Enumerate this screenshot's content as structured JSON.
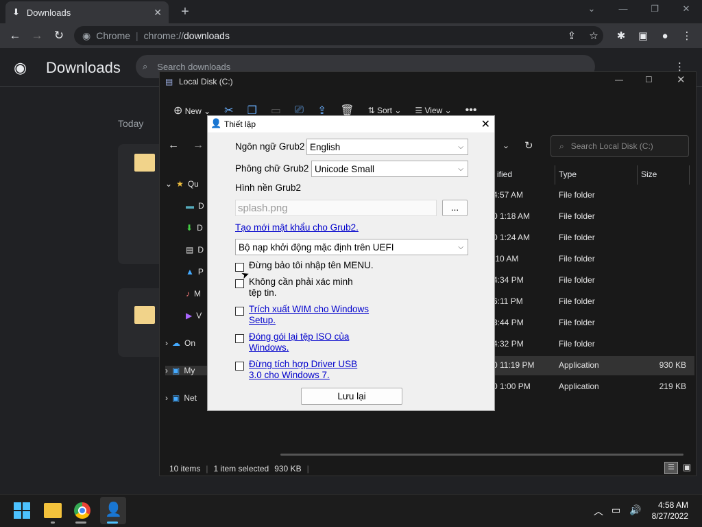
{
  "chrome": {
    "tab_title": "Downloads",
    "url_host": "Chrome",
    "url_scheme": "chrome://",
    "url_path": "downloads"
  },
  "downloads": {
    "title": "Downloads",
    "search_placeholder": "Search downloads",
    "section": "Today"
  },
  "explorer": {
    "title": "Local Disk (C:)",
    "toolbar": {
      "new": "New",
      "sort": "Sort",
      "view": "View"
    },
    "search_placeholder": "Search Local Disk (C:)",
    "columns": {
      "modified_partial": "ified",
      "type": "Type",
      "size": "Size"
    },
    "nav": [
      "Qu",
      "D",
      "D",
      "D",
      "P",
      "M",
      "V",
      "On",
      "My",
      "Net"
    ],
    "rows": [
      {
        "date": "4:57 AM",
        "type": "File folder",
        "size": ""
      },
      {
        "date": "0 1:18 AM",
        "type": "File folder",
        "size": ""
      },
      {
        "date": "0 1:24 AM",
        "type": "File folder",
        "size": ""
      },
      {
        "date": ":10 AM",
        "type": "File folder",
        "size": ""
      },
      {
        "date": "4:34 PM",
        "type": "File folder",
        "size": ""
      },
      {
        "date": "6:11 PM",
        "type": "File folder",
        "size": ""
      },
      {
        "date": "3:44 PM",
        "type": "File folder",
        "size": ""
      },
      {
        "date": "4:32 PM",
        "type": "File folder",
        "size": ""
      },
      {
        "date": "0 11:19 PM",
        "type": "Application",
        "size": "930 KB"
      },
      {
        "date": "0 1:00 PM",
        "type": "Application",
        "size": "219 KB"
      }
    ],
    "status": {
      "items": "10 items",
      "selected": "1 item selected",
      "selected_size": "930 KB"
    }
  },
  "dialog": {
    "title": "Thiết lập",
    "lang_label": "Ngôn ngữ Grub2",
    "lang_value": "English",
    "font_label": "Phông chữ Grub2",
    "font_value": "Unicode Small",
    "bg_label": "Hình nền Grub2",
    "bg_placeholder": "splash.png",
    "browse": "...",
    "password_link": "Tạo mới mật khẩu cho Grub2.",
    "uefi_value": "Bộ nạp khởi động mặc định trên UEFI",
    "checks": [
      {
        "line1": "Đừng bảo tôi nhập tên MENU.",
        "line2": "",
        "link": false
      },
      {
        "line1": "Không cần phải xác minh",
        "line2": "tệp tin.",
        "link": false
      },
      {
        "line1": "Trích xuất WIM cho Windows",
        "line2": "Setup.",
        "link": true
      },
      {
        "line1": "Đóng gói lại tệp ISO của",
        "line2": "Windows.",
        "link": true
      },
      {
        "line1": "Đừng tích hợp Driver USB",
        "line2": "3.0 cho Windows 7.",
        "link": true
      }
    ],
    "save": "Lưu lại"
  },
  "taskbar": {
    "time": "4:58 AM",
    "date": "8/27/2022"
  }
}
